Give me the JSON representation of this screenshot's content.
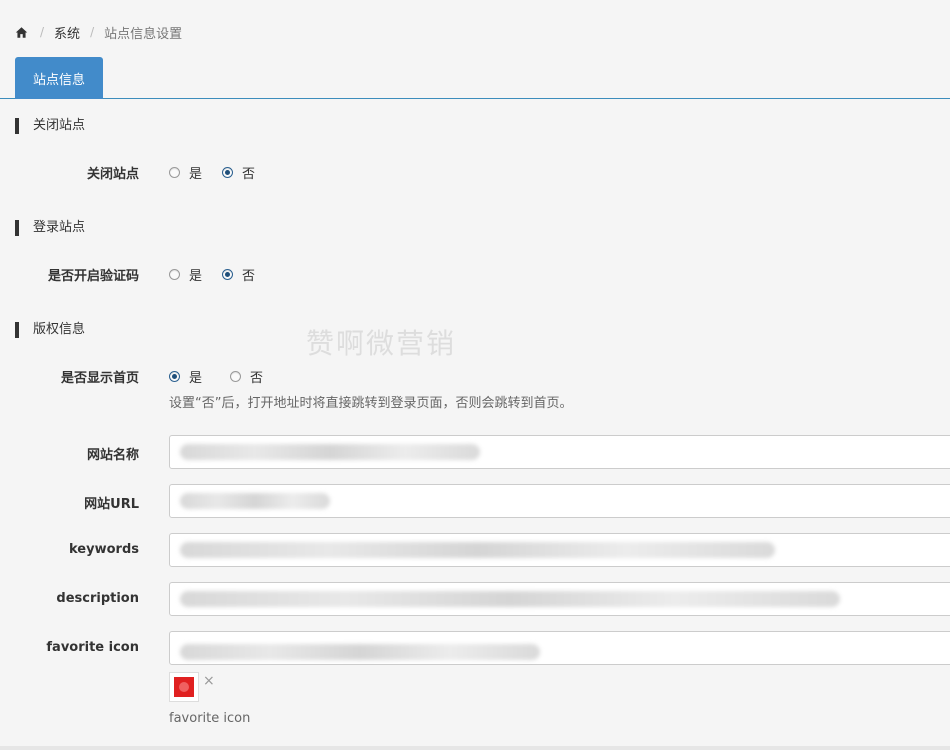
{
  "breadcrumb": {
    "home_icon": "home-icon",
    "separator": "/",
    "items": [
      "系统",
      "站点信息设置"
    ]
  },
  "tabs": [
    {
      "label": "站点信息",
      "active": true
    }
  ],
  "sections": {
    "close_site": {
      "title": "关闭站点",
      "field_label": "关闭站点",
      "options": [
        "是",
        "否"
      ],
      "selected": "否"
    },
    "login_site": {
      "title": "登录站点",
      "field_label": "是否开启验证码",
      "options": [
        "是",
        "否"
      ],
      "selected": "否"
    },
    "copyright": {
      "title": "版权信息",
      "field_label": "是否显示首页",
      "options": [
        "是",
        "否"
      ],
      "selected": "是",
      "help_text": "设置“否”后，打开地址时将直接跳转到登录页面，否则会跳转到首页。"
    }
  },
  "fields": {
    "site_name": {
      "label": "网站名称",
      "value": ""
    },
    "site_url": {
      "label": "网站URL",
      "value": ""
    },
    "keywords": {
      "label": "keywords",
      "value": ""
    },
    "description": {
      "label": "description",
      "value": ""
    },
    "favorite_icon": {
      "label": "favorite icon",
      "value": "",
      "caption": "favorite icon",
      "remove_symbol": "×"
    }
  },
  "watermark": "赞啊微营销",
  "colors": {
    "tab_active": "#428bca",
    "tab_border": "#3c8dbc",
    "favicon_swatch": "#e02020"
  }
}
